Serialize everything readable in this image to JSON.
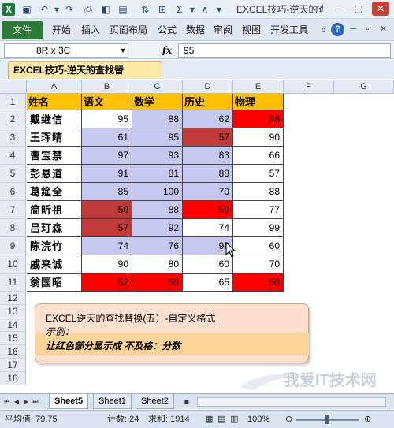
{
  "title": "EXCEL技巧-逆天的查...",
  "window_buttons": {
    "minimize": "─",
    "restore": "▢",
    "close": "✕"
  },
  "ribbon": {
    "file": "文件",
    "tabs": [
      "开始",
      "插入",
      "页面布局",
      "公式",
      "数据",
      "审阅",
      "视图",
      "开发工具"
    ]
  },
  "formula_bar": {
    "name_box": "8R x 3C",
    "fx": "fx",
    "value": "95"
  },
  "workbook_tab": "EXCEL技巧-逆天的查找替换！.xlsx",
  "columns": [
    "A",
    "B",
    "C",
    "D",
    "E",
    "F",
    "G"
  ],
  "rows": [
    "1",
    "2",
    "3",
    "4",
    "5",
    "6",
    "7",
    "8",
    "9",
    "10",
    "11",
    "12",
    "13",
    "14",
    "15",
    "16",
    "17",
    "18"
  ],
  "table": {
    "headers": [
      "姓名",
      "语文",
      "数学",
      "历史",
      "物理"
    ],
    "records": [
      {
        "name": "戴继信",
        "scores": [
          "95",
          "88",
          "62",
          "58"
        ]
      },
      {
        "name": "王珲晴",
        "scores": [
          "61",
          "95",
          "57",
          "90"
        ]
      },
      {
        "name": "曹宝禁",
        "scores": [
          "97",
          "93",
          "83",
          "66"
        ]
      },
      {
        "name": "彭悬道",
        "scores": [
          "91",
          "81",
          "88",
          "57"
        ]
      },
      {
        "name": "葛筵全",
        "scores": [
          "85",
          "100",
          "70",
          "88"
        ]
      },
      {
        "name": "简昕祖",
        "scores": [
          "50",
          "88",
          "59",
          "77"
        ]
      },
      {
        "name": "吕玎森",
        "scores": [
          "57",
          "92",
          "74",
          "99"
        ]
      },
      {
        "name": "陈浣竹",
        "scores": [
          "74",
          "76",
          "98",
          "60"
        ]
      },
      {
        "name": "戚来诚",
        "scores": [
          "90",
          "80",
          "60",
          "70"
        ]
      },
      {
        "name": "翁国昭",
        "scores": [
          "52",
          "50",
          "65",
          "50"
        ]
      }
    ]
  },
  "colors": {
    "header_fill": "#ffc000",
    "selection": "#c5c9f0",
    "red": "#ff0000",
    "red_dim": "#c03a3a",
    "note_fill": "#fde0d0",
    "note_highlight": "#fbd49a",
    "file_tab": "#2e7a3a"
  },
  "note": {
    "line1": "EXCEL逆天的查找替换(五）-自定义格式",
    "line2": "示例：",
    "line3": "让红色部分显示成 不及格：分数"
  },
  "sheet_tabs": [
    "Sheet5",
    "Sheet1",
    "Sheet2"
  ],
  "status": {
    "average": "平均值: 79.75",
    "count": "计数: 24",
    "sum": "求和: 1914",
    "zoom": "100%"
  },
  "watermark": "我爱IT技术网"
}
